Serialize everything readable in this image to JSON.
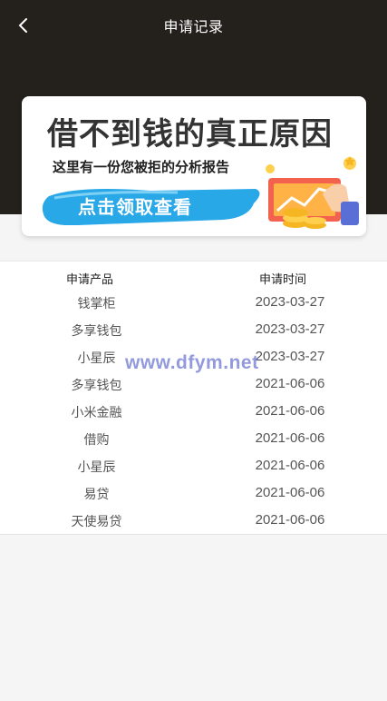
{
  "header": {
    "title": "申请记录",
    "back_icon": "chevron-left-icon"
  },
  "banner": {
    "headline": "借不到钱的真正原因",
    "subtitle": "这里有一份您被拒的分析报告",
    "cta": "点击领取查看",
    "accent_color": "#29a8e8"
  },
  "table": {
    "headers": {
      "product": "申请产品",
      "time": "申请时间"
    },
    "rows": [
      {
        "product": "钱掌柜",
        "time": "2023-03-27"
      },
      {
        "product": "多享钱包",
        "time": "2023-03-27"
      },
      {
        "product": "小星辰",
        "time": "2023-03-27"
      },
      {
        "product": "多享钱包",
        "time": "2021-06-06"
      },
      {
        "product": "小米金融",
        "time": "2021-06-06"
      },
      {
        "product": "借购",
        "time": "2021-06-06"
      },
      {
        "product": "小星辰",
        "time": "2021-06-06"
      },
      {
        "product": "易贷",
        "time": "2021-06-06"
      },
      {
        "product": "天使易贷",
        "time": "2021-06-06"
      }
    ]
  },
  "watermark": "www.dfym.net"
}
